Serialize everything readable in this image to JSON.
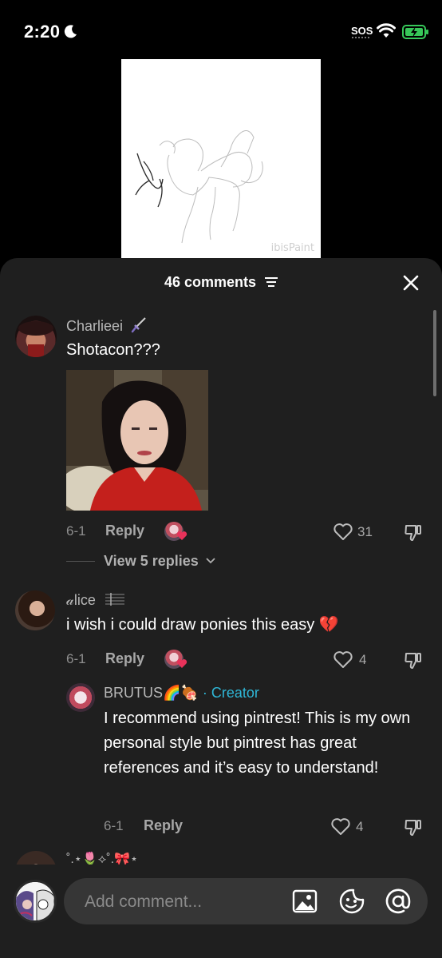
{
  "status_bar": {
    "time": "2:20",
    "sos": "SOS",
    "moon_icon": "moon-icon",
    "wifi_icon": "wifi-icon",
    "battery_icon": "battery-charging-icon"
  },
  "preview": {
    "watermark": "ibisPaint"
  },
  "sheet": {
    "comment_count": "46 comments",
    "filter_icon": "filter-icon",
    "close_icon": "close-icon"
  },
  "comments": [
    {
      "username": "Charlieei",
      "username_badge_icon": "dagger-icon",
      "text": "Shotacon???",
      "has_image": true,
      "date": "6-1",
      "reply_label": "Reply",
      "likes": "31",
      "view_replies": "View 5 replies"
    },
    {
      "username": "𝒶lice",
      "username_badge_icon": "music-staff-icon",
      "text": "i wish i could draw ponies this easy 💔",
      "date": "6-1",
      "reply_label": "Reply",
      "likes": "4",
      "replies": [
        {
          "username": "BRUTUS🌈🍖",
          "creator_label": "· Creator",
          "text": "I recommend using pintrest! This is my own personal style but pintrest has great references and it’s easy to understand!",
          "date": "6-1",
          "reply_label": "Reply",
          "likes": "4"
        }
      ]
    },
    {
      "username": "˚.⋆🌷⟡˚.🎀⋆"
    }
  ],
  "composer": {
    "placeholder": "Add comment...",
    "image_icon": "image-icon",
    "emoji_icon": "emoji-sticker-icon",
    "mention_icon": "at-mention-icon"
  },
  "colors": {
    "sheet_bg": "#1f1f1f",
    "creator_accent": "#2fb6d6",
    "heart_red": "#e8325a"
  }
}
